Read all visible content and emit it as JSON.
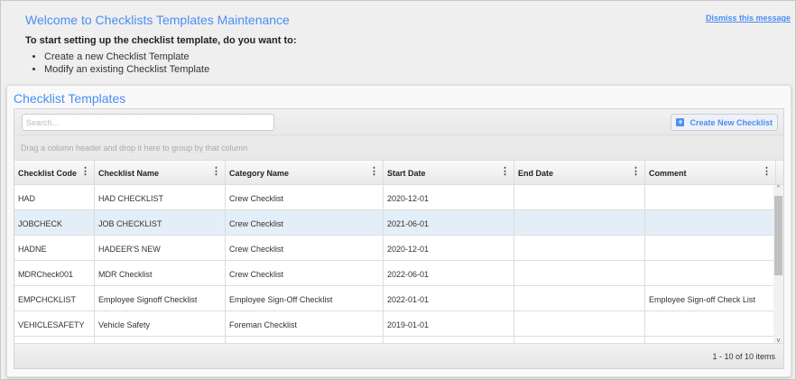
{
  "welcome": {
    "title": "Welcome to Checklists Templates Maintenance",
    "dismiss": "Dismiss this message",
    "intro": "To start setting up the checklist template, do you want to:",
    "options": [
      "Create a new Checklist Template",
      "Modify an existing Checklist Template"
    ]
  },
  "panel": {
    "title": "Checklist Templates",
    "search_placeholder": "Search...",
    "create_label": "Create New Checklist",
    "group_hint": "Drag a column header and drop it here to group by that column"
  },
  "columns": [
    "Checklist Code",
    "Checklist Name",
    "Category Name",
    "Start Date",
    "End Date",
    "Comment"
  ],
  "rows": [
    [
      "HAD",
      "HAD CHECKLIST",
      "Crew Checklist",
      "2020-12-01",
      "",
      ""
    ],
    [
      "JOBCHECK",
      "JOB CHECKLIST",
      "Crew Checklist",
      "2021-06-01",
      "",
      ""
    ],
    [
      "HADNE",
      "HADEER'S NEW",
      "Crew Checklist",
      "2020-12-01",
      "",
      ""
    ],
    [
      "MDRCheck001",
      "MDR Checklist",
      "Crew Checklist",
      "2022-06-01",
      "",
      ""
    ],
    [
      "EMPCHCKLIST",
      "Employee Signoff Checklist",
      "Employee Sign-Off Checklist",
      "2022-01-01",
      "",
      "Employee Sign-off Check List"
    ],
    [
      "VEHICLESAFETY",
      "Vehicle Safety",
      "Foreman Checklist",
      "2019-01-01",
      "",
      ""
    ],
    [
      "",
      "",
      "",
      "",
      "",
      ""
    ]
  ],
  "selected_row": 1,
  "pager": "1 - 10 of 10 items"
}
